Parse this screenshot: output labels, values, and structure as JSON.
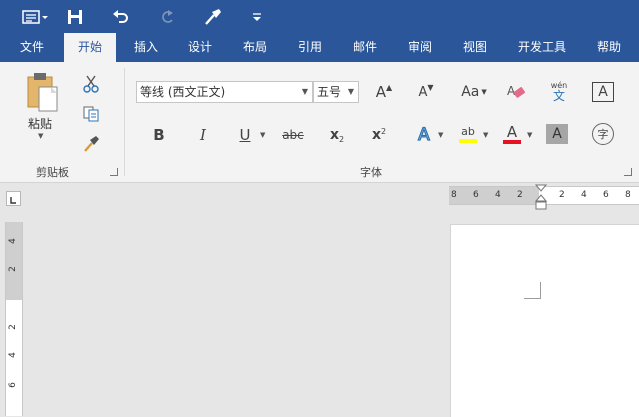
{
  "quick_access": {
    "items": [
      {
        "name": "layout-icon"
      },
      {
        "name": "save-icon"
      },
      {
        "name": "undo-icon"
      },
      {
        "name": "redo-icon"
      },
      {
        "name": "format-painter-icon"
      },
      {
        "name": "customize-icon"
      }
    ]
  },
  "tabs": [
    {
      "label": "文件"
    },
    {
      "label": "开始",
      "active": true
    },
    {
      "label": "插入"
    },
    {
      "label": "设计"
    },
    {
      "label": "布局"
    },
    {
      "label": "引用"
    },
    {
      "label": "邮件"
    },
    {
      "label": "审阅"
    },
    {
      "label": "视图"
    },
    {
      "label": "开发工具"
    },
    {
      "label": "帮助"
    }
  ],
  "clipboard": {
    "paste_label": "粘贴",
    "group_label": "剪贴板"
  },
  "font": {
    "font_name": "等线 (西文正文)",
    "font_size": "五号",
    "group_label": "字体",
    "bold": "B",
    "italic": "I",
    "underline": "U",
    "strike": "abc",
    "subscript_base": "x",
    "subscript_mark": "2",
    "superscript_base": "x",
    "superscript_mark": "2",
    "grow": "A",
    "shrink": "A",
    "change_case": "Aa",
    "phonetic_top": "wén",
    "phonetic_bottom": "文",
    "border_char": "A",
    "effects": "A",
    "highlight": "ab",
    "font_color": "A",
    "char_shading": "A",
    "enclose_char": "字"
  },
  "colors": {
    "accent": "#2b579a",
    "highlight_yellow": "#ffff00",
    "font_red": "#e81123"
  },
  "ruler": {
    "h_numbers": [
      "8",
      "6",
      "4",
      "2",
      "2",
      "4",
      "6",
      "8"
    ],
    "v_numbers": [
      "4",
      "2",
      "2",
      "4",
      "6"
    ]
  }
}
